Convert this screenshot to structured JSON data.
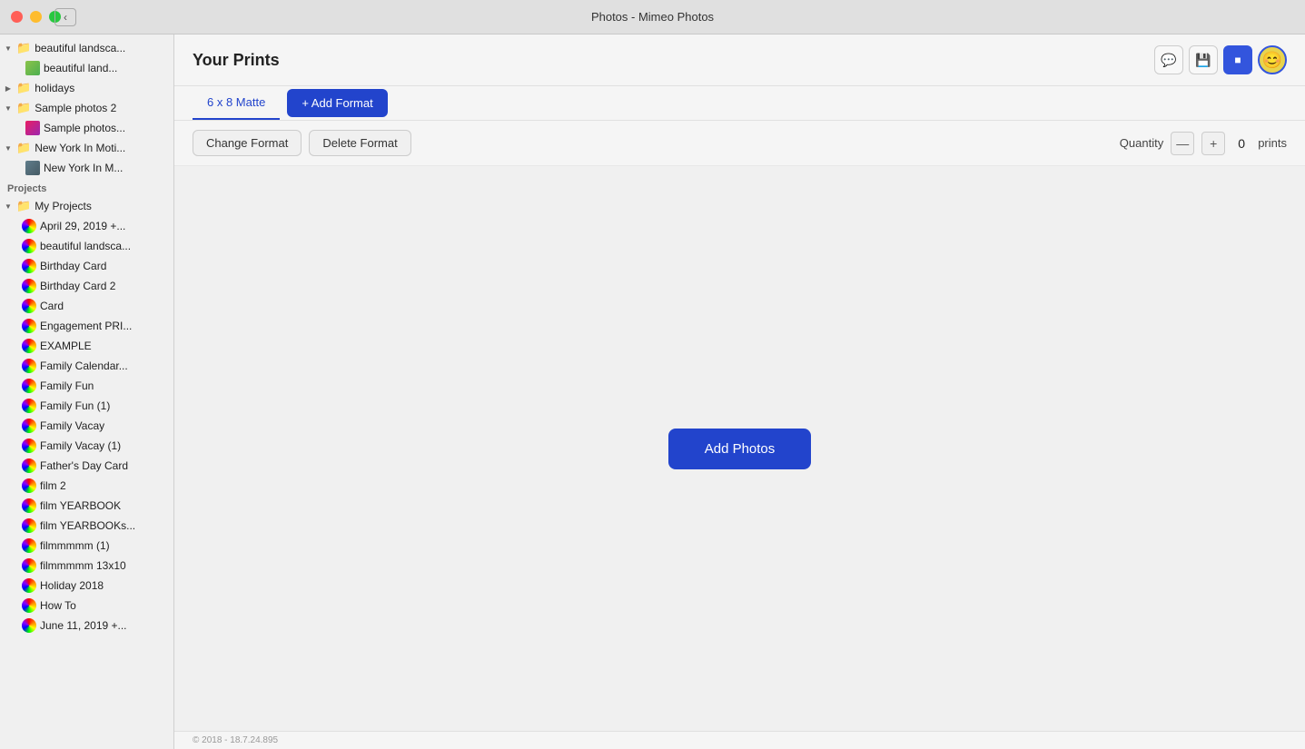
{
  "titlebar": {
    "title": "Photos - Mimeo Photos",
    "buttons": {
      "close": "close",
      "minimize": "minimize",
      "maximize": "maximize"
    }
  },
  "sidebar": {
    "folders": [
      {
        "id": "beautiful-landsca",
        "label": "beautiful landsca...",
        "level": 1,
        "expanded": true,
        "type": "group"
      },
      {
        "id": "beautiful-land",
        "label": "beautiful land...",
        "level": 2,
        "type": "item"
      },
      {
        "id": "holidays",
        "label": "holidays",
        "level": 1,
        "type": "group-closed"
      },
      {
        "id": "sample-photos-2",
        "label": "Sample photos 2",
        "level": 1,
        "expanded": true,
        "type": "group"
      },
      {
        "id": "sample-photos",
        "label": "Sample photos...",
        "level": 2,
        "type": "item"
      },
      {
        "id": "new-york-in-moti",
        "label": "New York In Moti...",
        "level": 1,
        "expanded": true,
        "type": "group"
      },
      {
        "id": "new-york-in-m",
        "label": "New York In M...",
        "level": 2,
        "type": "item"
      }
    ],
    "projects_label": "Projects",
    "projects_group": "My Projects",
    "projects": [
      "April 29, 2019 +...",
      "beautiful landsca...",
      "Birthday Card",
      "Birthday Card 2",
      "Card",
      "Engagement PRI...",
      "EXAMPLE",
      "Family Calendar...",
      "Family Fun",
      "Family Fun (1)",
      "Family Vacay",
      "Family Vacay (1)",
      "Father's Day Card",
      "film 2",
      "film YEARBOOK",
      "film YEARBOOKs...",
      "filmmmmm (1)",
      "filmmmmm 13x10",
      "Holiday 2018",
      "How To",
      "June 11, 2019 +..."
    ]
  },
  "content": {
    "title": "Your Prints",
    "tabs": [
      {
        "id": "6x8-matte",
        "label": "6 x 8 Matte",
        "active": true
      },
      {
        "id": "add-format",
        "label": "+ Add Format",
        "active": false
      }
    ],
    "toolbar": {
      "change_format": "Change Format",
      "delete_format": "Delete Format",
      "quantity_label": "Quantity",
      "quantity_value": "0",
      "prints_label": "prints",
      "minus": "—",
      "plus": "+"
    },
    "body": {
      "add_photos_label": "Add Photos"
    },
    "footer": {
      "copyright": "© 2018 - 18.7.24.895"
    }
  },
  "header_icons": {
    "chat_icon": "💬",
    "save_icon": "💾",
    "avatar_color": "#e8d44d"
  }
}
